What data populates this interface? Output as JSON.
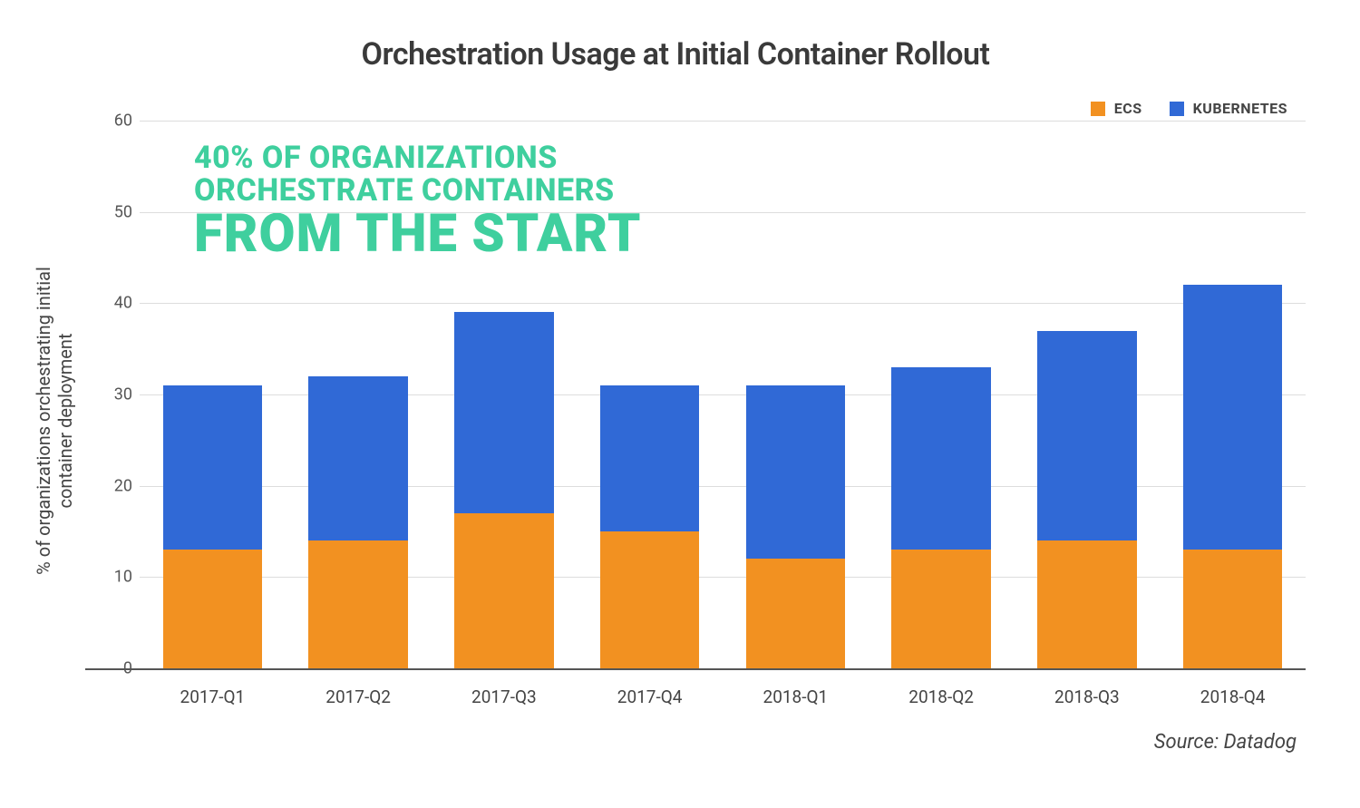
{
  "chart_data": {
    "type": "bar",
    "stacked": true,
    "title": "Orchestration Usage at Initial Container Rollout",
    "ylabel": "% of organizations orchestrating initial\ncontainer deployment",
    "xlabel": "",
    "ylim": [
      0,
      60
    ],
    "yticks": [
      0,
      10,
      20,
      30,
      40,
      50,
      60
    ],
    "categories": [
      "2017-Q1",
      "2017-Q2",
      "2017-Q3",
      "2017-Q4",
      "2018-Q1",
      "2018-Q2",
      "2018-Q3",
      "2018-Q4"
    ],
    "series": [
      {
        "name": "ECS",
        "color": "#f29121",
        "values": [
          13,
          14,
          17,
          15,
          12,
          13,
          14,
          13
        ]
      },
      {
        "name": "KUBERNETES",
        "color": "#3069d6",
        "values": [
          18,
          18,
          22,
          16,
          19,
          20,
          23,
          29
        ]
      }
    ],
    "annotation": {
      "line1": "40% OF ORGANIZATIONS",
      "line2": "ORCHESTRATE CONTAINERS",
      "line3": "FROM THE START",
      "color": "#3fcf9e"
    },
    "source": "Source: Datadog",
    "legend_position": "top-right",
    "grid": true
  }
}
